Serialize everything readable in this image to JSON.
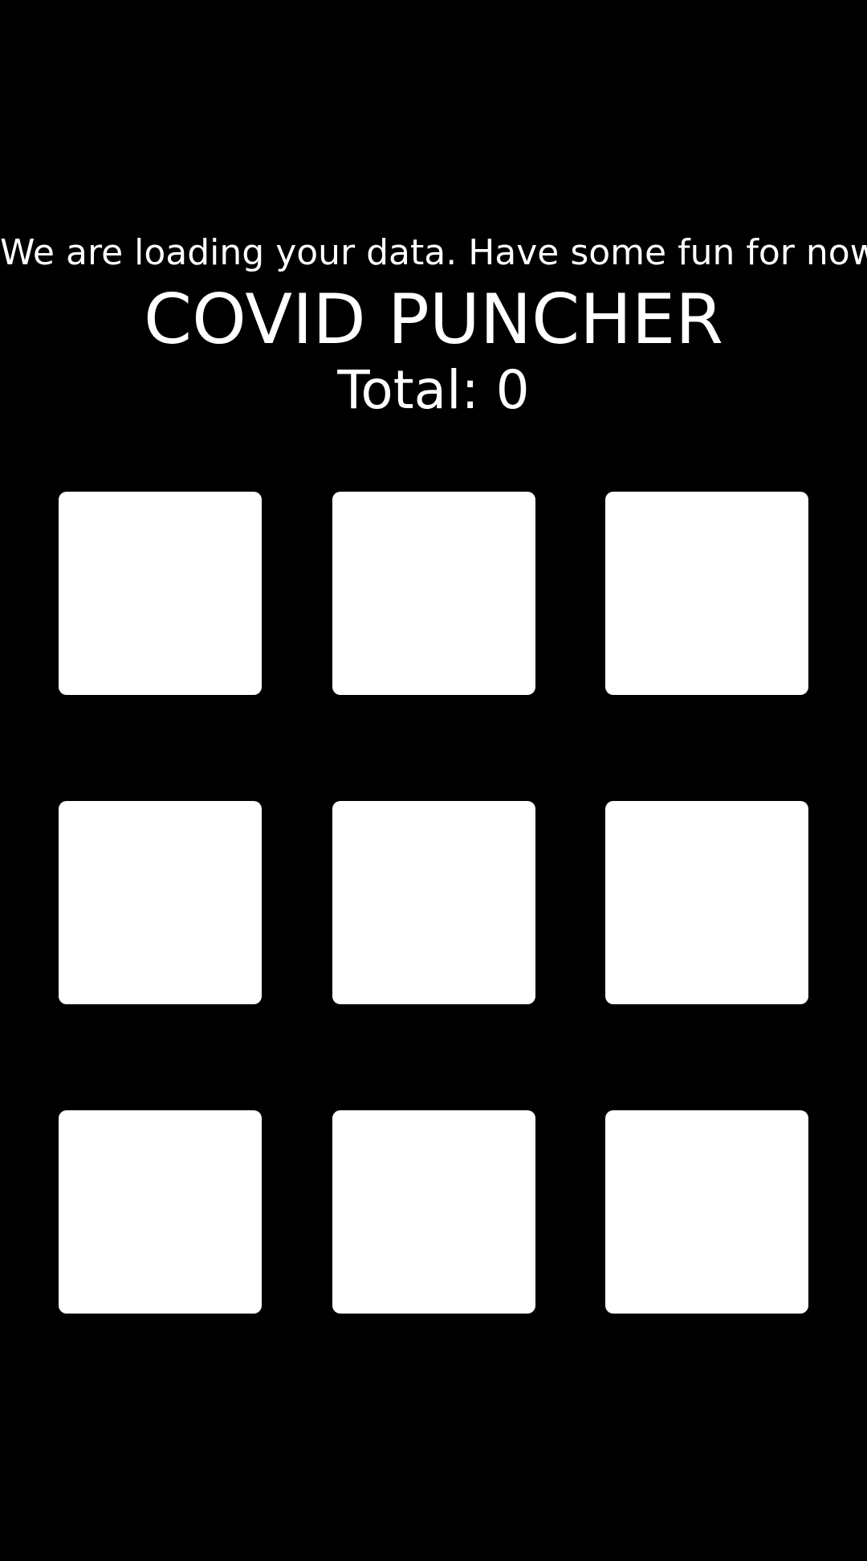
{
  "loading_message": "We are loading your data. Have some fun for now",
  "game": {
    "title": "COVID PUNCHER",
    "total_label": "Total: 0",
    "total": 0
  },
  "grid": {
    "rows": 3,
    "columns": 3,
    "tile_color": "#ffffff"
  },
  "colors": {
    "background": "#000000",
    "text": "#ffffff"
  }
}
